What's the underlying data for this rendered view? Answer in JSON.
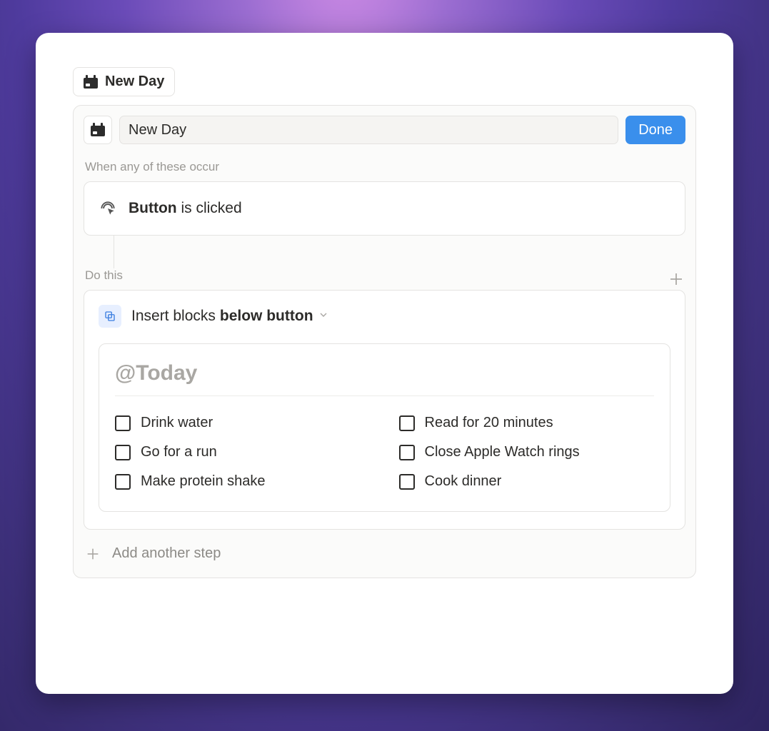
{
  "pill": {
    "label": "New Day"
  },
  "panel": {
    "title_value": "New Day",
    "done_label": "Done",
    "trigger_section_label": "When any of these occur",
    "trigger": {
      "strong": "Button",
      "rest": " is clicked"
    },
    "action_section_label": "Do this",
    "action": {
      "prefix": "Insert blocks ",
      "strong": "below button",
      "heading": "@Today",
      "todos_left": [
        "Drink water",
        "Go for a run",
        "Make protein shake"
      ],
      "todos_right": [
        "Read for 20 minutes",
        "Close Apple Watch rings",
        "Cook dinner"
      ]
    },
    "add_step_label": "Add another step"
  }
}
